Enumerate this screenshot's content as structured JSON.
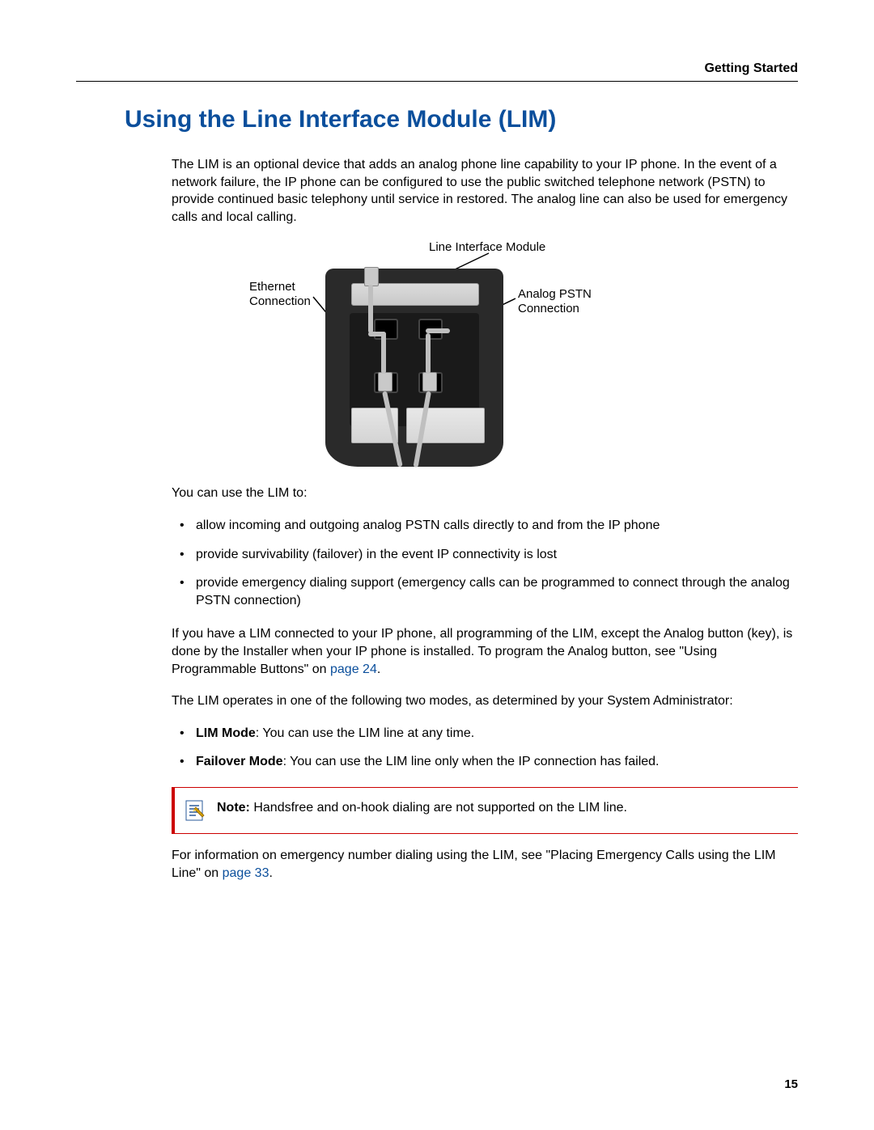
{
  "header": {
    "section": "Getting Started"
  },
  "title": "Using the Line Interface Module (LIM)",
  "intro": "The LIM is an optional device that adds an analog phone line capability to your IP phone. In the event of a network failure, the IP phone can be configured to use the public switched telephone network (PSTN) to provide continued basic telephony until service in restored. The analog line can also be used for emergency calls and local calling.",
  "figure": {
    "label_top": "Line Interface Module",
    "label_left": "Ethernet\nConnection",
    "label_right": "Analog PSTN\nConnection"
  },
  "uses_intro": "You can use the LIM to:",
  "uses": [
    "allow incoming and outgoing analog PSTN calls directly to and from the IP phone",
    "provide survivability (failover) in the event IP connectivity is lost",
    "provide emergency dialing support (emergency calls can be programmed to connect through the analog PSTN connection)"
  ],
  "programming_prefix": "If you have a LIM connected to your IP phone, all programming of the LIM, except the Analog button (key), is done by the Installer when your IP phone is installed. To program the Analog button, see \"Using Programmable Buttons\" on ",
  "programming_link": "page 24",
  "programming_suffix": ".",
  "modes_intro": "The LIM operates in one of the following two modes, as determined by your System Administrator:",
  "modes": [
    {
      "name": "LIM Mode",
      "desc": ": You can use the LIM line at any time."
    },
    {
      "name": "Failover Mode",
      "desc": ": You can use the LIM line only when the IP connection has failed."
    }
  ],
  "note": {
    "label": "Note:",
    "text": " Handsfree and on-hook dialing are not supported on the LIM line."
  },
  "emergency_prefix": "For information on emergency number dialing using the LIM, see \"Placing Emergency Calls using the LIM Line\" on ",
  "emergency_link": "page 33",
  "emergency_suffix": ".",
  "page_number": "15"
}
